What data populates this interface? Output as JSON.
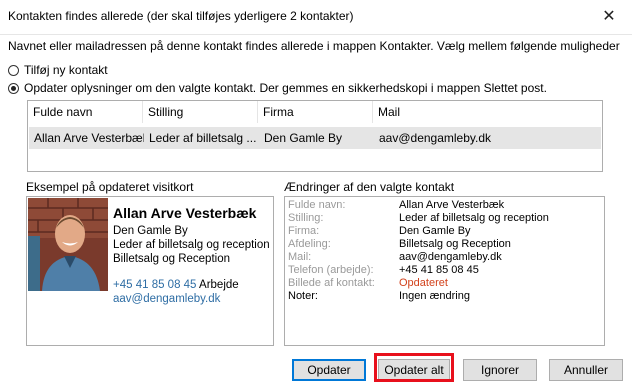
{
  "window": {
    "title": "Kontakten findes allerede (der skal tilføjes yderligere 2 kontakter)",
    "close_glyph": "✕"
  },
  "intro": "Navnet eller mailadressen på denne kontakt findes allerede i mappen Kontakter. Vælg mellem følgende muligheder",
  "options": [
    {
      "label": "Tilføj ny kontakt",
      "selected": false
    },
    {
      "label": "Opdater oplysninger om den valgte kontakt. Der gemmes en sikkerhedskopi i mappen Slettet post.",
      "selected": true
    }
  ],
  "list": {
    "columns": [
      "Fulde navn",
      "Stilling",
      "Firma",
      "Mail"
    ],
    "rows": [
      [
        "Allan Arve Vesterbæk",
        "Leder af billetsalg ...",
        "Den Gamle By",
        "aav@dengamleby.dk"
      ]
    ]
  },
  "preview": {
    "label": "Eksempel på opdateret visitkort",
    "name": "Allan Arve Vesterbæk",
    "company": "Den Gamle By",
    "title": "Leder af billetsalg og reception",
    "department": "Billetsalg og Reception",
    "phone": "+45 41 85 08 45",
    "phone_label": "Arbejde",
    "email": "aav@dengamleby.dk",
    "photo_icon": "person-photo"
  },
  "changes": {
    "label": "Ændringer af den valgte kontakt",
    "rows": [
      {
        "field": "Fulde navn:",
        "value": "Allan Arve Vesterbæk"
      },
      {
        "field": "Stilling:",
        "value": "Leder af billetsalg og reception"
      },
      {
        "field": "Firma:",
        "value": "Den Gamle By"
      },
      {
        "field": "Afdeling:",
        "value": "Billetsalg og Reception"
      },
      {
        "field": "Mail:",
        "value": "aav@dengamleby.dk"
      },
      {
        "field": "Telefon (arbejde):",
        "value": "+45 41 85 08 45"
      },
      {
        "field": "Billede af kontakt:",
        "value": "Opdateret"
      },
      {
        "field": "Noter:",
        "value": "Ingen ændring"
      }
    ],
    "highlight_color": "#d2421c"
  },
  "buttons": {
    "update": "Opdater",
    "update_all": "Opdater alt",
    "ignore": "Ignorer",
    "cancel": "Annuller"
  },
  "accent": "#0078d7",
  "annotation_color": "#e8101c"
}
